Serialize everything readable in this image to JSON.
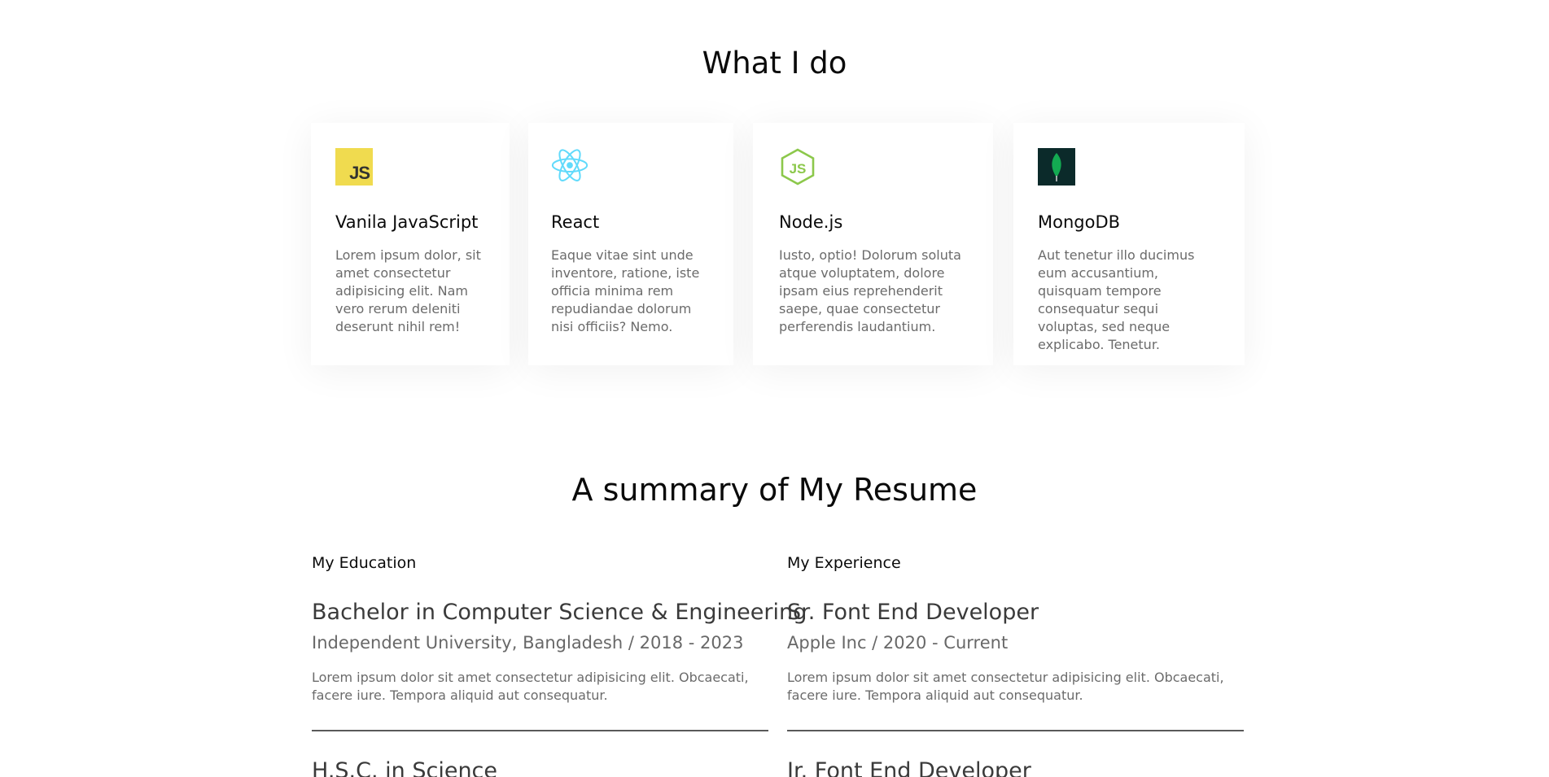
{
  "what_i_do": {
    "title": "What I do",
    "cards": [
      {
        "icon": "javascript-icon",
        "icon_text": "JS",
        "title": "Vanila JavaScript",
        "text": "Lorem ipsum dolor, sit amet consectetur adipisicing elit. Nam vero rerum deleniti deserunt nihil rem!"
      },
      {
        "icon": "react-icon",
        "title": "React",
        "text": "Eaque vitae sint unde inventore, ratione, iste officia minima rem repudiandae dolorum nisi officiis? Nemo."
      },
      {
        "icon": "nodejs-icon",
        "title": "Node.js",
        "text": "Iusto, optio! Dolorum soluta atque voluptatem, dolore ipsam eius reprehenderit saepe, quae consectetur perferendis laudantium."
      },
      {
        "icon": "mongodb-icon",
        "title": "MongoDB",
        "text": "Aut tenetur illo ducimus eum accusantium, quisquam tempore consequatur sequi voluptas, sed neque explicabo. Tenetur."
      }
    ]
  },
  "resume": {
    "title": "A summary of My Resume",
    "education": {
      "heading": "My Education",
      "entries": [
        {
          "title": "Bachelor in Computer Science & Engineering",
          "subtitle": "Independent University, Bangladesh / 2018 - 2023",
          "text": "Lorem ipsum dolor sit amet consectetur adipisicing elit. Obcaecati, facere iure. Tempora aliquid aut consequatur."
        },
        {
          "title": "H.S.C. in Science"
        }
      ]
    },
    "experience": {
      "heading": "My Experience",
      "entries": [
        {
          "title": "Sr. Font End Developer",
          "subtitle": "Apple Inc / 2020 - Current",
          "text": "Lorem ipsum dolor sit amet consectetur adipisicing elit. Obcaecati, facere iure. Tempora aliquid aut consequatur."
        },
        {
          "title": "Jr. Font End Developer"
        }
      ]
    }
  },
  "colors": {
    "js_yellow": "#f0db4f",
    "react_cyan": "#61dafb",
    "node_green": "#8cc84b",
    "mongo_green": "#13aa52",
    "mongo_bg": "#0b2a2a"
  }
}
